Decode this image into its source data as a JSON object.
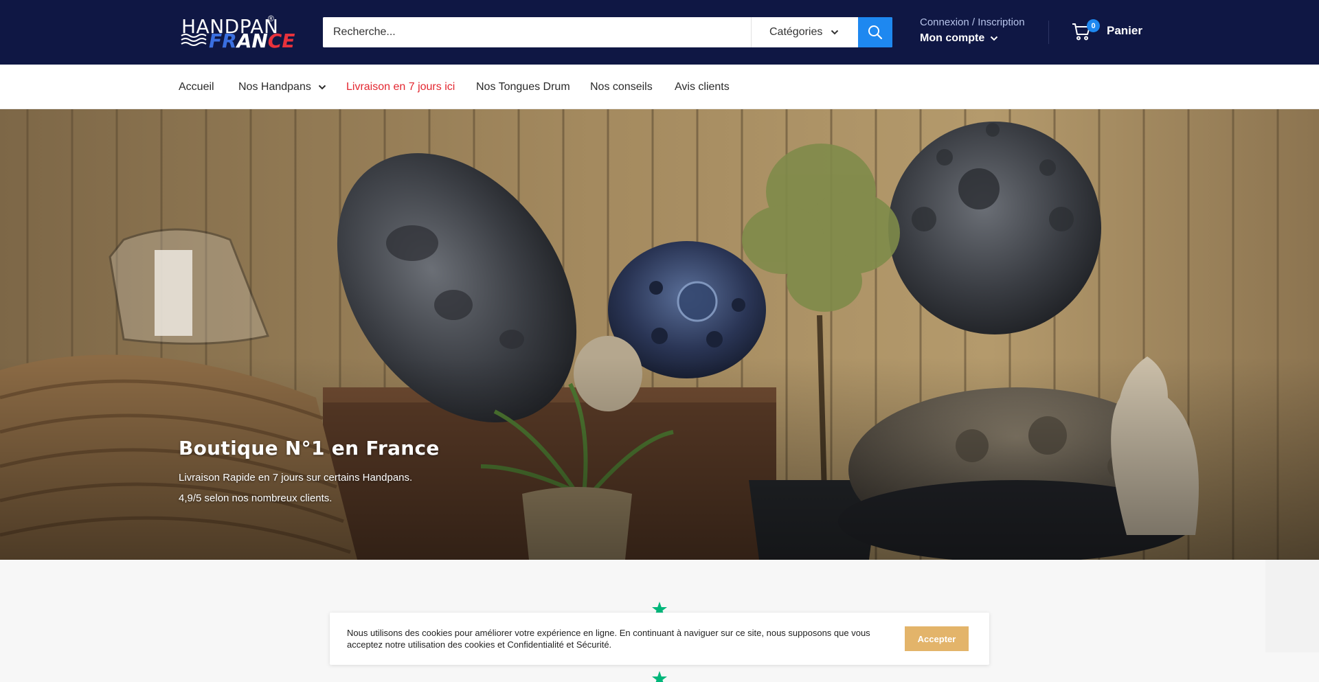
{
  "brand": {
    "logo_line1": "HANDPAN",
    "logo_reg": "®",
    "logo_line2_part1": "FR",
    "logo_line2_part2": "AN",
    "logo_line2_part3": "CE"
  },
  "header": {
    "search_placeholder": "Recherche...",
    "categories_label": "Catégories",
    "account_login": "Connexion / Inscription",
    "account_label": "Mon compte",
    "cart_count": "0",
    "cart_label": "Panier"
  },
  "nav": {
    "items": [
      {
        "label": "Accueil"
      },
      {
        "label": "Nos Handpans"
      },
      {
        "label": "Livraison en 7 jours ici"
      },
      {
        "label": "Nos Tongues Drum"
      },
      {
        "label": "Nos conseils"
      },
      {
        "label": "Avis clients"
      }
    ]
  },
  "hero": {
    "title": "Boutique N°1 en France",
    "line1": "Livraison Rapide en 7 jours sur certains Handpans.",
    "line2": "4,9/5 selon nos nombreux clients."
  },
  "cookie": {
    "message": "Nous utilisons des cookies pour améliorer votre expérience en ligne. En continuant à naviguer sur ce site, nous supposons que vous acceptez notre utilisation des cookies et Confidentialité et Sécurité.",
    "accept_label": "Accepter"
  },
  "colors": {
    "header_bg": "#0f1744",
    "accent_blue": "#1e88f0",
    "nav_highlight": "#e3262f",
    "accept_button": "#e3b46a",
    "star_green": "#00b67a"
  },
  "icons": [
    "search-icon",
    "chevron-down-icon",
    "cart-icon",
    "star-icon"
  ]
}
